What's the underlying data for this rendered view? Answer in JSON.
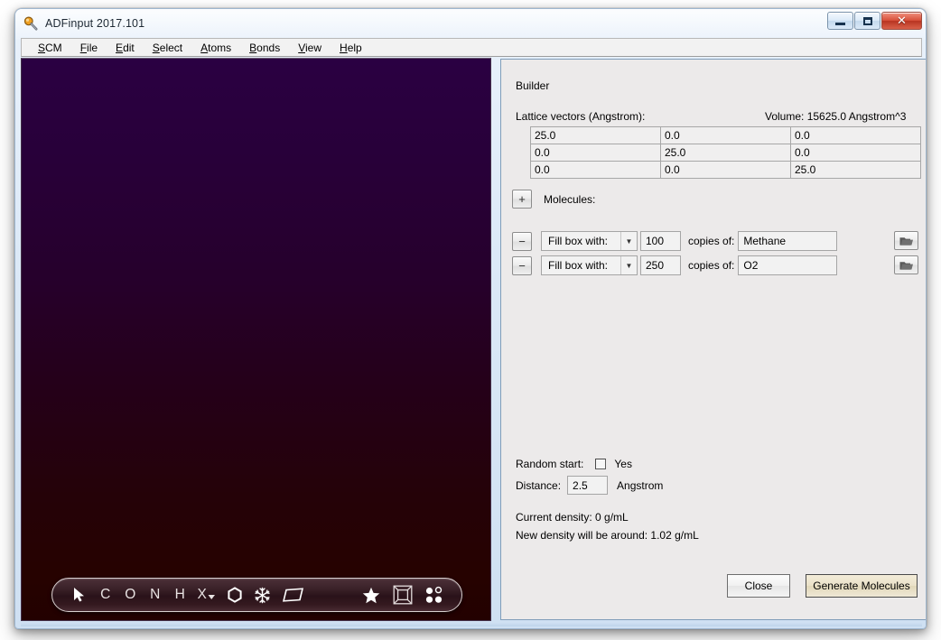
{
  "window": {
    "title": "ADFinput 2017.101",
    "app_icon": "magnifier-icon",
    "controls": {
      "minimize": "minimize-button",
      "maximize": "maximize-button",
      "close_label": "✕"
    }
  },
  "menubar": {
    "items": [
      {
        "mnemonic": "S",
        "rest": "CM"
      },
      {
        "mnemonic": "F",
        "rest": "ile"
      },
      {
        "mnemonic": "E",
        "rest": "dit"
      },
      {
        "mnemonic": "S",
        "rest": "elect"
      },
      {
        "mnemonic": "A",
        "rest": "toms"
      },
      {
        "mnemonic": "B",
        "rest": "onds"
      },
      {
        "mnemonic": "V",
        "rest": "iew"
      },
      {
        "mnemonic": "H",
        "rest": "elp"
      }
    ]
  },
  "viewport": {
    "gradient_top": "#2a0042",
    "gradient_bottom": "#230100",
    "toolbar": {
      "items": [
        {
          "name": "select-cursor-icon",
          "glyph": "➤",
          "kind": "cursor"
        },
        {
          "name": "carbon-tool",
          "glyph": "C",
          "kind": "letter"
        },
        {
          "name": "oxygen-tool",
          "glyph": "O",
          "kind": "letter"
        },
        {
          "name": "nitrogen-tool",
          "glyph": "N",
          "kind": "letter"
        },
        {
          "name": "hydrogen-tool",
          "glyph": "H",
          "kind": "letter"
        },
        {
          "name": "other-element-tool",
          "glyph": "X",
          "kind": "letter-dropdown"
        },
        {
          "name": "benzene-ring-tool",
          "glyph": "⬡",
          "kind": "shape"
        },
        {
          "name": "snowflake-structure-tool",
          "glyph": "❄",
          "kind": "shape"
        },
        {
          "name": "plane-tool",
          "glyph": "▱",
          "kind": "shape"
        },
        {
          "name": "favorite-star-tool",
          "glyph": "★",
          "kind": "shape"
        },
        {
          "name": "periodic-box-tool",
          "glyph": "▣",
          "kind": "box"
        },
        {
          "name": "atoms-dots-tool",
          "glyph": "dots",
          "kind": "dots"
        }
      ]
    }
  },
  "builder": {
    "heading": "Builder",
    "lattice_label": "Lattice vectors (Angstrom):",
    "volume_label": "Volume: 15625.0 Angstrom^3",
    "lattice_vectors": [
      [
        "25.0",
        "0.0",
        "0.0"
      ],
      [
        "0.0",
        "25.0",
        "0.0"
      ],
      [
        "0.0",
        "0.0",
        "25.0"
      ]
    ],
    "add_button_label": "+",
    "molecules_label": "Molecules:",
    "molecule_rows": [
      {
        "remove_label": "−",
        "mode": "Fill box with:",
        "count": "100",
        "copies_label": "copies of:",
        "molecule": "Methane",
        "browse_icon": "folder-icon"
      },
      {
        "remove_label": "−",
        "mode": "Fill box with:",
        "count": "250",
        "copies_label": "copies of:",
        "molecule": "O2",
        "browse_icon": "folder-icon"
      }
    ],
    "random_start_label": "Random start:",
    "random_start_yes": "Yes",
    "random_start_checked": false,
    "distance_label": "Distance:",
    "distance_value": "2.5",
    "distance_unit": "Angstrom",
    "current_density": "Current density: 0 g/mL",
    "new_density": "New density will be around: 1.02 g/mL",
    "close_button": "Close",
    "generate_button": "Generate Molecules",
    "default_button_accent": "#e1d7b9"
  }
}
